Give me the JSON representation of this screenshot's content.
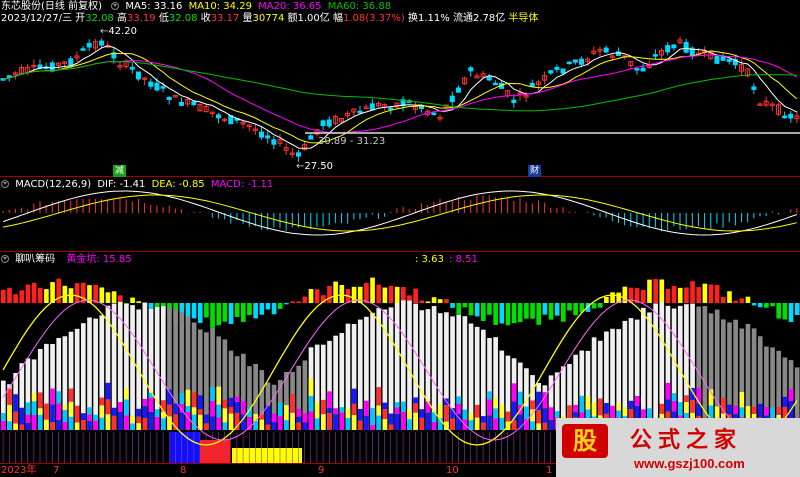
{
  "header": {
    "stock": "东芯股份(日线 前复权)",
    "ma5": "MA5: 33.16",
    "ma10": "MA10: 34.29",
    "ma20": "MA20: 36.65",
    "ma60": "MA60: 36.88"
  },
  "info": {
    "date": "2023/12/27/三",
    "open_label": "开",
    "open": "32.08",
    "high_label": "高",
    "high": "33.19",
    "low_label": "低",
    "low": "32.08",
    "close_label": "收",
    "close": "33.17",
    "volume_label": "量",
    "volume": "30774",
    "amount": "额1.00亿",
    "change_label": "幅",
    "change": "1.08(3.37%)",
    "turnover": "换1.11%",
    "float_cap": "流通2.78亿",
    "industry": "半导体"
  },
  "price_panel": {
    "high_mark": "42.20",
    "low_mark": "27.50",
    "range_label": "30.89 - 31.23",
    "tag_reduce": "减",
    "tag_finance": "财"
  },
  "macd_panel": {
    "title": "MACD(12,26,9)",
    "dif": "DIF: -1.41",
    "dea": "DEA: -0.85",
    "macd": "MACD: -1.11"
  },
  "chip_panel": {
    "title": "聊叭筹码",
    "gold_label": "黄金坑: 15.85",
    "val1": ": 3.63",
    "val2": ": 8.51"
  },
  "axis": {
    "year": "2023年",
    "months": [
      "7",
      "8",
      "9",
      "10",
      "1"
    ]
  },
  "watermark": {
    "logo": "股",
    "title": "公式之家",
    "url": "www.gszj100.com"
  },
  "colors": {
    "up": "#ff3333",
    "down": "#00d8ff",
    "ma5": "#ffffff",
    "ma10": "#ffff00",
    "ma20": "#ff00ff",
    "ma60": "#00c000",
    "panel_border": "#a00000"
  }
}
